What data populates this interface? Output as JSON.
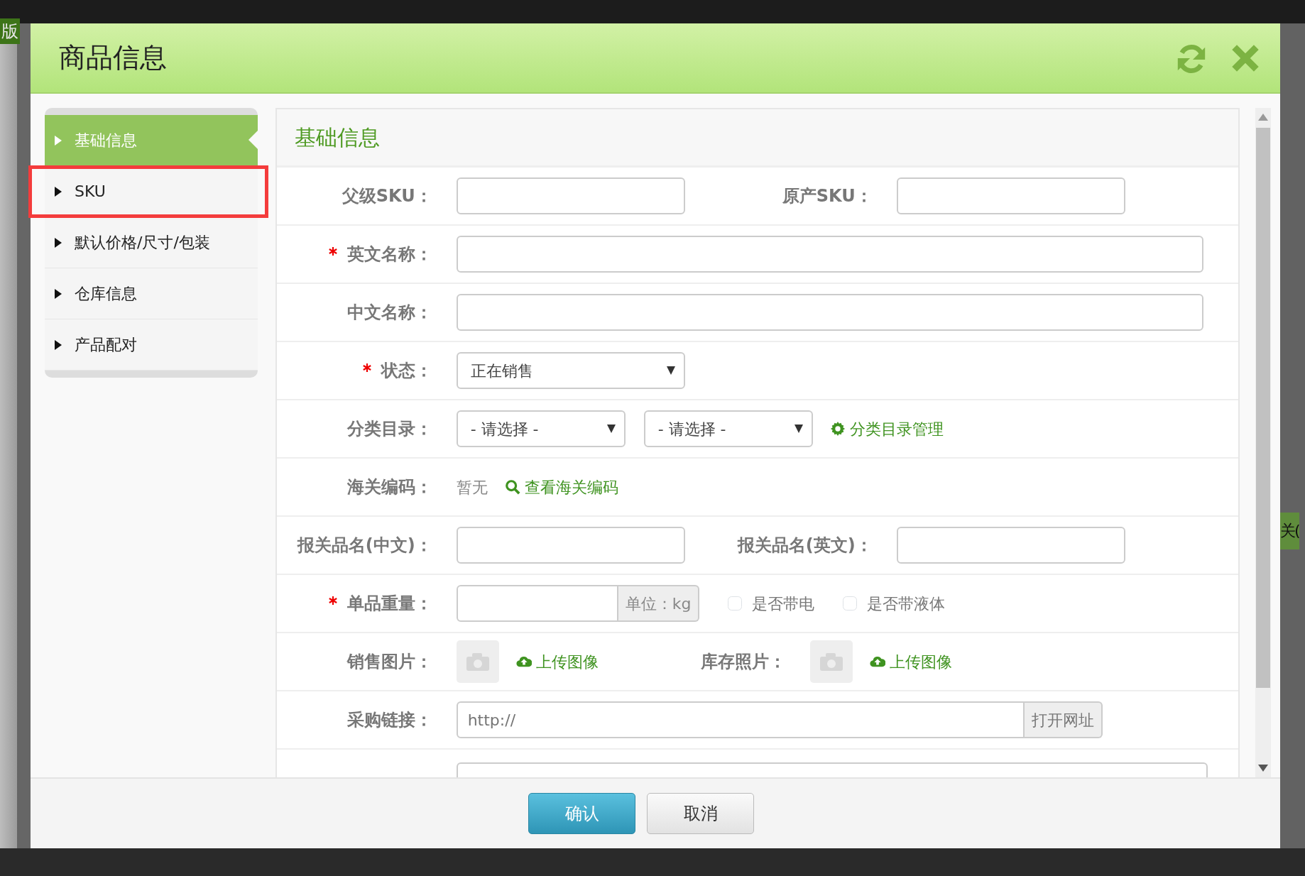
{
  "background": {
    "texts": [
      {
        "text": "版"
      },
      {
        "text": "关("
      }
    ]
  },
  "dialog": {
    "title": "商品信息"
  },
  "nav": [
    {
      "label": "基础信息",
      "selected": true,
      "highlighted": false
    },
    {
      "label": "SKU",
      "selected": false,
      "highlighted": true
    },
    {
      "label": "默认价格/尺寸/包装",
      "selected": false,
      "highlighted": false
    },
    {
      "label": "仓库信息",
      "selected": false,
      "highlighted": false
    },
    {
      "label": "产品配对",
      "selected": false,
      "highlighted": false
    }
  ],
  "section": {
    "title": "基础信息"
  },
  "rows": [
    {
      "groups": [
        {
          "label": "父级SKU：",
          "required": false,
          "controls": [
            {
              "kind": "input"
            }
          ]
        },
        {
          "label": "原产SKU：",
          "required": false,
          "controls": [
            {
              "kind": "input"
            }
          ]
        }
      ]
    },
    {
      "groups": [
        {
          "label": "英文名称：",
          "required": true,
          "controls": [
            {
              "kind": "input"
            }
          ]
        }
      ]
    },
    {
      "groups": [
        {
          "label": "中文名称：",
          "required": false,
          "controls": [
            {
              "kind": "input"
            }
          ]
        }
      ]
    },
    {
      "groups": [
        {
          "label": "状态：",
          "required": true,
          "controls": [
            {
              "kind": "select",
              "value": "正在销售"
            }
          ]
        }
      ]
    },
    {
      "groups": [
        {
          "label": "分类目录：",
          "required": false,
          "controls": [
            {
              "kind": "select",
              "value": "- 请选择 -"
            },
            {
              "kind": "select",
              "value": "- 请选择 -"
            },
            {
              "kind": "settings-link",
              "text": "分类目录管理"
            }
          ]
        }
      ]
    },
    {
      "groups": [
        {
          "label": "海关编码：",
          "required": false,
          "controls": [
            {
              "kind": "text",
              "text": "暂无"
            },
            {
              "kind": "search-link",
              "text": "查看海关编码"
            }
          ]
        }
      ]
    },
    {
      "groups": [
        {
          "label": "报关品名(中文)：",
          "required": false,
          "controls": [
            {
              "kind": "input"
            }
          ]
        },
        {
          "label": "报关品名(英文)：",
          "required": false,
          "controls": [
            {
              "kind": "input"
            }
          ]
        }
      ]
    },
    {
      "groups": [
        {
          "label": "单品重量：",
          "required": true,
          "controls": [
            {
              "kind": "unit-input",
              "unit": "单位：kg"
            },
            {
              "kind": "checkbox",
              "label": "是否带电",
              "checked": false
            },
            {
              "kind": "checkbox",
              "label": "是否带液体",
              "checked": false
            }
          ]
        }
      ]
    },
    {
      "groups": [
        {
          "label": "销售图片：",
          "required": false,
          "controls": [
            {
              "kind": "image"
            },
            {
              "kind": "upload-link",
              "text": "上传图像"
            }
          ]
        },
        {
          "label": "库存照片：",
          "required": false,
          "controls": [
            {
              "kind": "image"
            },
            {
              "kind": "upload-link",
              "text": "上传图像"
            }
          ]
        }
      ]
    },
    {
      "groups": [
        {
          "label": "采购链接：",
          "required": false,
          "controls": [
            {
              "kind": "url-input",
              "placeholder": "http://",
              "button": "打开网址"
            }
          ]
        }
      ]
    },
    {
      "groups": [
        {
          "controls": [
            {
              "kind": "textarea"
            }
          ]
        }
      ]
    }
  ],
  "buttons": [
    {
      "label": "确认",
      "kind": "primary"
    },
    {
      "label": "取消",
      "kind": "default"
    }
  ]
}
